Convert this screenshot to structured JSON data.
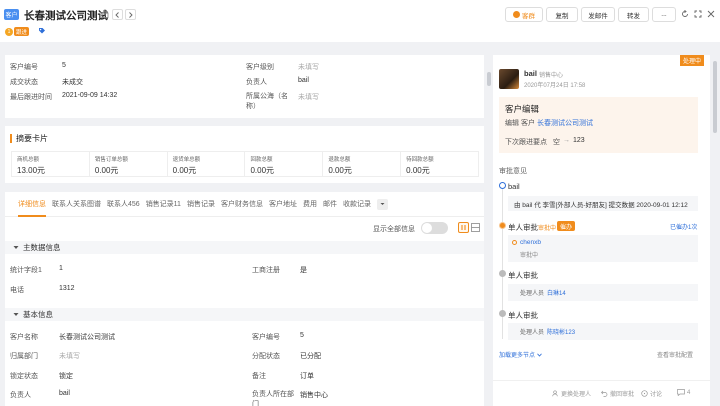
{
  "header": {
    "badge": "客户",
    "title": "长春测试公司测试",
    "sub_count": "1",
    "sub_tag": "跟进",
    "actions": {
      "primary": "客群",
      "copy": "复制",
      "email": "发邮件",
      "forward": "转发",
      "more": "..."
    }
  },
  "info": {
    "cust_no_label": "客户编号",
    "cust_no": "5",
    "deal_label": "成交状态",
    "deal": "未成交",
    "last_follow_label": "最后跟进时间",
    "last_follow": "2021-09-09 14:32",
    "level_label": "客户级别",
    "level": "未填写",
    "owner_label": "负责人",
    "owner": "bail",
    "sea_label": "所属公海（名称）",
    "sea": "未填写"
  },
  "summary": {
    "title": "摘要卡片",
    "items": [
      {
        "label": "商机总额",
        "value": "13.00元"
      },
      {
        "label": "销售订单总额",
        "value": "0.00元"
      },
      {
        "label": "退货单总额",
        "value": "0.00元"
      },
      {
        "label": "回款总额",
        "value": "0.00元"
      },
      {
        "label": "退款总额",
        "value": "0.00元"
      },
      {
        "label": "待回款总额",
        "value": "0.00元"
      }
    ]
  },
  "tabs": [
    "详细信息",
    "联系人关系图谱",
    "联系人456",
    "销售记录11",
    "销售记录",
    "客户财务信息",
    "客户地址",
    "费用",
    "邮件",
    "收款记录"
  ],
  "show_all_label": "显示全部信息",
  "main_section": {
    "title": "主数据信息",
    "stat_label": "统计字段1",
    "stat": "1",
    "biz_label": "工商注册",
    "biz": "是",
    "phone_label": "电话",
    "phone": "1312"
  },
  "basic_section": {
    "title": "基本信息",
    "name_label": "客户名称",
    "name": "长春测试公司测试",
    "no_label": "客户编号",
    "no": "5",
    "dept_label": "归属部门",
    "dept": "未填写",
    "assign_label": "分配状态",
    "assign": "已分配",
    "lock_label": "锁定状态",
    "lock": "锁定",
    "remark_label": "备注",
    "remark": "订单",
    "owner_label": "负责人",
    "owner": "bail",
    "owner_dept_label": "负责人所在部门",
    "owner_dept": "销售中心"
  },
  "approval": {
    "status": "处理中",
    "user": "bail",
    "user_dept": "销售中心",
    "time": "2020年07月24日 17:58",
    "edit_title": "客户编辑",
    "edit_prefix": "编辑 客户",
    "edit_link": "长春测试公司测试",
    "next_label": "下次跟进要点",
    "next_from": "空",
    "next_arrow": "→",
    "next_to": "123",
    "opinion_title": "审批意见",
    "node1_name": "bail",
    "node1_text": "由 bail 代 李雪[外部人员-好朋友] 提交数据 2020-09-01 12:12",
    "node2_title": "单人审批",
    "node2_status": "审批中",
    "node2_urge": "催办",
    "node2_urged": "已催办1次",
    "node2_person": "chenxb",
    "node2_person_status": "审批中",
    "node3_title": "单人审批",
    "node3_label": "处理人员",
    "node3_person": "白琳14",
    "node4_title": "单人审批",
    "node4_label": "处理人员",
    "node4_person": "陈晓彬123",
    "load_more": "加载更多节点",
    "view_flow": "查看审批配置",
    "footer": {
      "change": "更换处理人",
      "withdraw": "撤回审批",
      "discuss": "讨论",
      "comments": "4"
    }
  }
}
